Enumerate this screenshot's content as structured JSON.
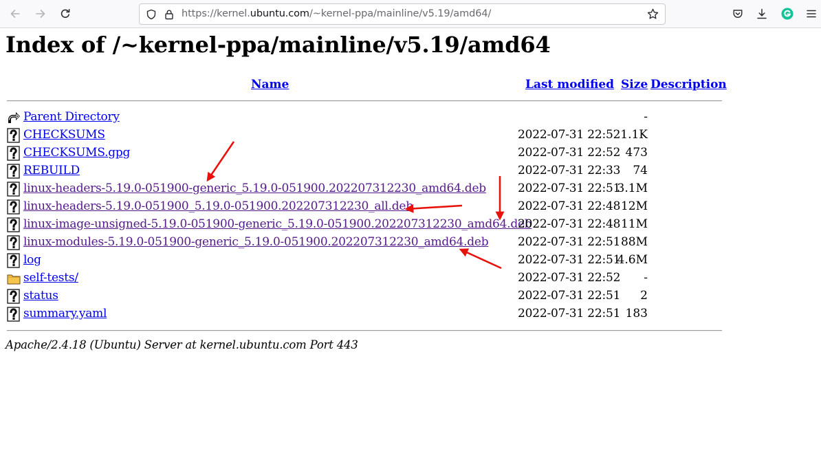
{
  "browser": {
    "url_prefix": "https://kernel.",
    "url_host": "ubuntu.com",
    "url_path": "/~kernel-ppa/mainline/v5.19/amd64/",
    "icons": {
      "back": "arrow-left-icon",
      "forward": "arrow-right-icon",
      "reload": "reload-icon",
      "tracking": "shield-icon",
      "security": "lock-icon",
      "bookmark": "star-icon",
      "pocket": "pocket-icon",
      "downloads": "download-icon",
      "extension": "grammarly-icon",
      "menu": "hamburger-menu-icon"
    },
    "extension_letter": "G"
  },
  "page": {
    "title": "Index of /~kernel-ppa/mainline/v5.19/amd64",
    "columns": {
      "name": "Name",
      "last_modified": "Last modified",
      "size": "Size",
      "description": "Description"
    },
    "rows": [
      {
        "icon": "parent-directory-icon",
        "name": "Parent Directory",
        "date": "",
        "size": "-",
        "visited": false
      },
      {
        "icon": "unknown-file-icon",
        "name": "CHECKSUMS",
        "date": "2022-07-31 22:52",
        "size": "1.1K",
        "visited": false
      },
      {
        "icon": "unknown-file-icon",
        "name": "CHECKSUMS.gpg",
        "date": "2022-07-31 22:52",
        "size": "473",
        "visited": false
      },
      {
        "icon": "unknown-file-icon",
        "name": "REBUILD",
        "date": "2022-07-31 22:33",
        "size": "74",
        "visited": false
      },
      {
        "icon": "unknown-file-icon",
        "name": "linux-headers-5.19.0-051900-generic_5.19.0-051900.202207312230_amd64.deb",
        "date": "2022-07-31 22:51",
        "size": "3.1M",
        "visited": true
      },
      {
        "icon": "unknown-file-icon",
        "name": "linux-headers-5.19.0-051900_5.19.0-051900.202207312230_all.deb",
        "date": "2022-07-31 22:48",
        "size": "12M",
        "visited": true
      },
      {
        "icon": "unknown-file-icon",
        "name": "linux-image-unsigned-5.19.0-051900-generic_5.19.0-051900.202207312230_amd64.deb",
        "date": "2022-07-31 22:48",
        "size": "11M",
        "visited": true
      },
      {
        "icon": "unknown-file-icon",
        "name": "linux-modules-5.19.0-051900-generic_5.19.0-051900.202207312230_amd64.deb",
        "date": "2022-07-31 22:51",
        "size": "88M",
        "visited": true
      },
      {
        "icon": "unknown-file-icon",
        "name": "log",
        "date": "2022-07-31 22:51",
        "size": "4.6M",
        "visited": false
      },
      {
        "icon": "folder-icon",
        "name": "self-tests/",
        "date": "2022-07-31 22:52",
        "size": "-",
        "visited": false
      },
      {
        "icon": "unknown-file-icon",
        "name": "status",
        "date": "2022-07-31 22:51",
        "size": "2",
        "visited": false
      },
      {
        "icon": "unknown-file-icon",
        "name": "summary.yaml",
        "date": "2022-07-31 22:51",
        "size": "183",
        "visited": false
      }
    ],
    "footer": "Apache/2.4.18 (Ubuntu) Server at kernel.ubuntu.com Port 443"
  },
  "annotations": {
    "arrow_color": "#e8120c",
    "arrow_count": 4
  }
}
